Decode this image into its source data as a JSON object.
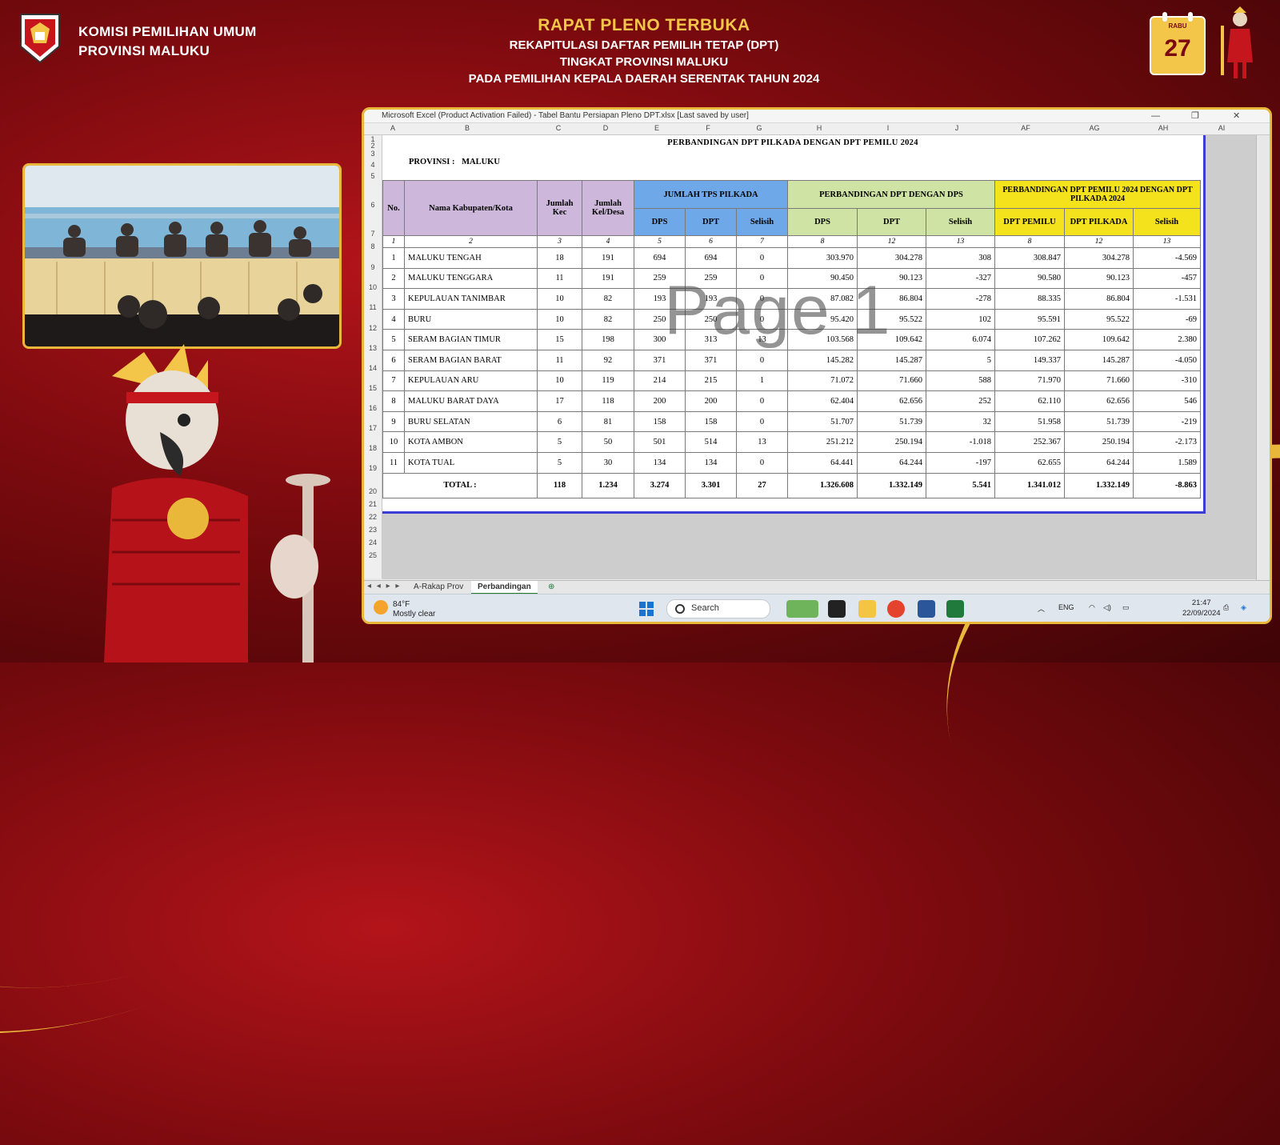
{
  "header": {
    "org_line1": "KOMISI PEMILIHAN UMUM",
    "org_line2": "PROVINSI MALUKU",
    "title1": "RAPAT PLENO TERBUKA",
    "title2": "REKAPITULASI DAFTAR PEMILIH TETAP (DPT)",
    "title3": "TINGKAT PROVINSI MALUKU",
    "title4": "PADA PEMILIHAN KEPALA DAERAH SERENTAK TAHUN 2024",
    "calendar_day_label": "RABU",
    "calendar_date": "27"
  },
  "excel": {
    "window_title": "Microsoft Excel (Product Activation Failed) - Tabel Bantu Persiapan Pleno DPT.xlsx [Last saved by user]",
    "columns": [
      "A",
      "B",
      "C",
      "D",
      "E",
      "F",
      "G",
      "H",
      "I",
      "J",
      "AF",
      "AG",
      "AH",
      "AI"
    ],
    "rows": [
      "1",
      "2",
      "3",
      "4",
      "5",
      "6",
      "7",
      "8",
      "9",
      "10",
      "11",
      "12",
      "13",
      "14",
      "15",
      "16",
      "17",
      "18",
      "19",
      "20",
      "21",
      "22",
      "23",
      "24",
      "25"
    ],
    "sheet_title": "PERBANDINGAN DPT PILKADA DENGAN DPT PEMILU 2024",
    "province_label": "PROVINSI :",
    "province_value": "MALUKU",
    "headers": {
      "no": "No.",
      "name": "Nama Kabupaten/Kota",
      "kec": "Jumlah Kec",
      "kel": "Jumlah Kel/Desa",
      "tps_group": "JUMLAH TPS PILKADA",
      "dps_group": "PERBANDINGAN DPT DENGAN DPS",
      "pemilu_group": "PERBANDINGAN DPT PEMILU 2024 DENGAN DPT PILKADA 2024",
      "dps": "DPS",
      "dpt": "DPT",
      "selisih": "Selisih",
      "dpt_pemilu": "DPT PEMILU",
      "dpt_pilkada": "DPT PILKADA"
    },
    "col_numbers": [
      "1",
      "2",
      "3",
      "4",
      "5",
      "6",
      "7",
      "8",
      "12",
      "13",
      "8",
      "12",
      "13"
    ],
    "data_rows": [
      [
        "1",
        "MALUKU TENGAH",
        "18",
        "191",
        "694",
        "694",
        "0",
        "303.970",
        "304.278",
        "308",
        "308.847",
        "304.278",
        "-4.569"
      ],
      [
        "2",
        "MALUKU TENGGARA",
        "11",
        "191",
        "259",
        "259",
        "0",
        "90.450",
        "90.123",
        "-327",
        "90.580",
        "90.123",
        "-457"
      ],
      [
        "3",
        "KEPULAUAN TANIMBAR",
        "10",
        "82",
        "193",
        "193",
        "0",
        "87.082",
        "86.804",
        "-278",
        "88.335",
        "86.804",
        "-1.531"
      ],
      [
        "4",
        "BURU",
        "10",
        "82",
        "250",
        "250",
        "0",
        "95.420",
        "95.522",
        "102",
        "95.591",
        "95.522",
        "-69"
      ],
      [
        "5",
        "SERAM BAGIAN TIMUR",
        "15",
        "198",
        "300",
        "313",
        "13",
        "103.568",
        "109.642",
        "6.074",
        "107.262",
        "109.642",
        "2.380"
      ],
      [
        "6",
        "SERAM BAGIAN BARAT",
        "11",
        "92",
        "371",
        "371",
        "0",
        "145.282",
        "145.287",
        "5",
        "149.337",
        "145.287",
        "-4.050"
      ],
      [
        "7",
        "KEPULAUAN ARU",
        "10",
        "119",
        "214",
        "215",
        "1",
        "71.072",
        "71.660",
        "588",
        "71.970",
        "71.660",
        "-310"
      ],
      [
        "8",
        "MALUKU BARAT DAYA",
        "17",
        "118",
        "200",
        "200",
        "0",
        "62.404",
        "62.656",
        "252",
        "62.110",
        "62.656",
        "546"
      ],
      [
        "9",
        "BURU SELATAN",
        "6",
        "81",
        "158",
        "158",
        "0",
        "51.707",
        "51.739",
        "32",
        "51.958",
        "51.739",
        "-219"
      ],
      [
        "10",
        "KOTA AMBON",
        "5",
        "50",
        "501",
        "514",
        "13",
        "251.212",
        "250.194",
        "-1.018",
        "252.367",
        "250.194",
        "-2.173"
      ],
      [
        "11",
        "KOTA TUAL",
        "5",
        "30",
        "134",
        "134",
        "0",
        "64.441",
        "64.244",
        "-197",
        "62.655",
        "64.244",
        "1.589"
      ]
    ],
    "total": {
      "label": "TOTAL :",
      "values": [
        "118",
        "1.234",
        "3.274",
        "3.301",
        "27",
        "1.326.608",
        "1.332.149",
        "5.541",
        "1.341.012",
        "1.332.149",
        "-8.863"
      ]
    },
    "watermark": "Page 1",
    "sheet_tabs": [
      "A-Rakap Prov",
      "Perbandingan"
    ],
    "active_tab": "Perbandingan"
  },
  "taskbar": {
    "weather_temp": "84°F",
    "weather_desc": "Mostly clear",
    "search_label": "Search",
    "lang": "ENG",
    "time": "21:47",
    "date": "22/09/2024"
  },
  "colors": {
    "purple_header": "#cdb8dc",
    "blue_header": "#6fa8e8",
    "green_header": "#cfe3a4",
    "yellow_header": "#f4e21d",
    "frame_gold": "#e9b73a"
  }
}
